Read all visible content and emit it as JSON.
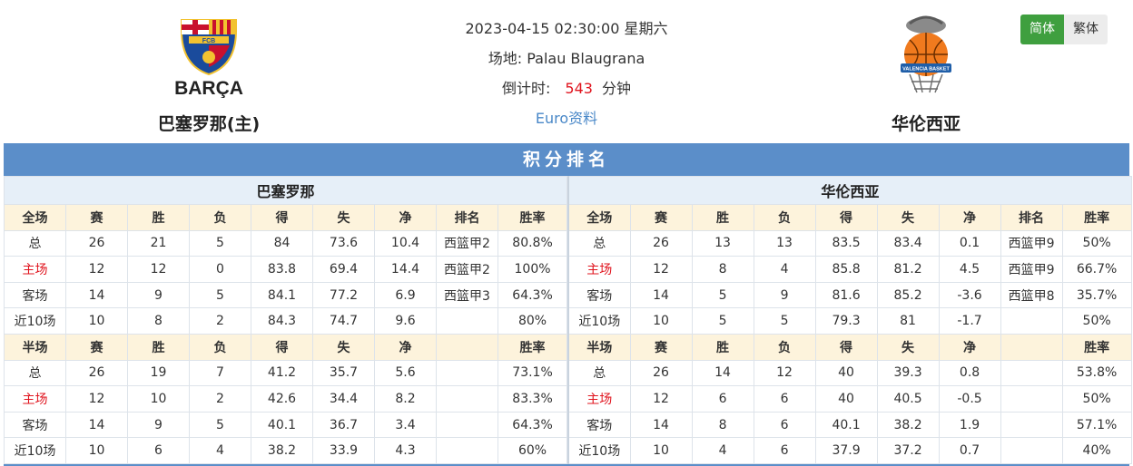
{
  "home": {
    "name": "巴塞罗那(主)",
    "logo_text": "BARÇA",
    "logo_crest_text": "FCB",
    "table_title": "巴塞罗那",
    "colors": {
      "blue": "#1a4b9c",
      "red": "#c8102e",
      "gold": "#f2c230"
    }
  },
  "away": {
    "name": "华伦西亚",
    "logo_text": "VALENCIA BASKET",
    "table_title": "华伦西亚",
    "colors": {
      "orange": "#f07a1e",
      "blue": "#1f5ea8",
      "gray": "#8a8a8a"
    }
  },
  "match": {
    "datetime": "2023-04-15 02:30:00 星期六",
    "venue_label": "场地:",
    "venue": "Palau Blaugrana",
    "countdown_label": "倒计时:",
    "countdown_value": "543",
    "countdown_unit": "分钟",
    "link": "Euro资料"
  },
  "lang": {
    "simplified": "简体",
    "traditional": "繁体"
  },
  "section_title": "积分排名",
  "headers_full": [
    "全场",
    "赛",
    "胜",
    "负",
    "得",
    "失",
    "净",
    "排名",
    "胜率"
  ],
  "headers_half": [
    "半场",
    "赛",
    "胜",
    "负",
    "得",
    "失",
    "净",
    "",
    "胜率"
  ],
  "home_full": [
    [
      "总",
      "26",
      "21",
      "5",
      "84",
      "73.6",
      "10.4",
      "西篮甲2",
      "80.8%"
    ],
    [
      "主场",
      "12",
      "12",
      "0",
      "83.8",
      "69.4",
      "14.4",
      "西篮甲2",
      "100%"
    ],
    [
      "客场",
      "14",
      "9",
      "5",
      "84.1",
      "77.2",
      "6.9",
      "西篮甲3",
      "64.3%"
    ],
    [
      "近10场",
      "10",
      "8",
      "2",
      "84.3",
      "74.7",
      "9.6",
      "",
      "80%"
    ]
  ],
  "home_half": [
    [
      "总",
      "26",
      "19",
      "7",
      "41.2",
      "35.7",
      "5.6",
      "",
      "73.1%"
    ],
    [
      "主场",
      "12",
      "10",
      "2",
      "42.6",
      "34.4",
      "8.2",
      "",
      "83.3%"
    ],
    [
      "客场",
      "14",
      "9",
      "5",
      "40.1",
      "36.7",
      "3.4",
      "",
      "64.3%"
    ],
    [
      "近10场",
      "10",
      "6",
      "4",
      "38.2",
      "33.9",
      "4.3",
      "",
      "60%"
    ]
  ],
  "away_full": [
    [
      "总",
      "26",
      "13",
      "13",
      "83.5",
      "83.4",
      "0.1",
      "西篮甲9",
      "50%"
    ],
    [
      "主场",
      "12",
      "8",
      "4",
      "85.8",
      "81.2",
      "4.5",
      "西篮甲9",
      "66.7%"
    ],
    [
      "客场",
      "14",
      "5",
      "9",
      "81.6",
      "85.2",
      "-3.6",
      "西篮甲8",
      "35.7%"
    ],
    [
      "近10场",
      "10",
      "5",
      "5",
      "79.3",
      "81",
      "-1.7",
      "",
      "50%"
    ]
  ],
  "away_half": [
    [
      "总",
      "26",
      "14",
      "12",
      "40",
      "39.3",
      "0.8",
      "",
      "53.8%"
    ],
    [
      "主场",
      "12",
      "6",
      "6",
      "40",
      "40.5",
      "-0.5",
      "",
      "50%"
    ],
    [
      "客场",
      "14",
      "8",
      "6",
      "40.1",
      "38.2",
      "1.9",
      "",
      "57.1%"
    ],
    [
      "近10场",
      "10",
      "4",
      "6",
      "37.9",
      "37.2",
      "0.7",
      "",
      "40%"
    ]
  ]
}
